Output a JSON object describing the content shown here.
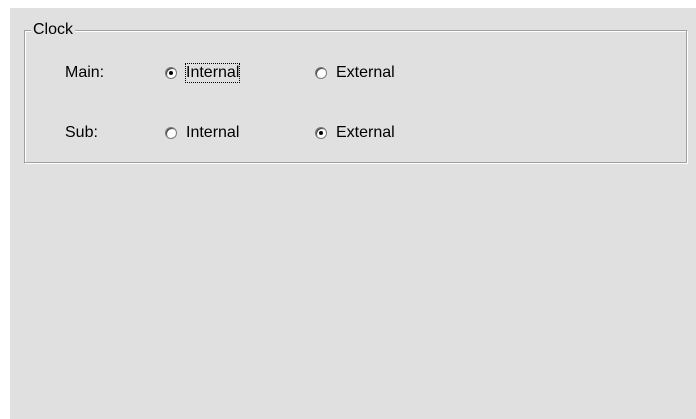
{
  "group": {
    "title": "Clock"
  },
  "rows": [
    {
      "label": "Main:",
      "options": [
        {
          "label": "Internal",
          "checked": true,
          "focused": true
        },
        {
          "label": "External",
          "checked": false,
          "focused": false
        }
      ]
    },
    {
      "label": "Sub:",
      "options": [
        {
          "label": "Internal",
          "checked": false,
          "focused": false
        },
        {
          "label": "External",
          "checked": true,
          "focused": false
        }
      ]
    }
  ]
}
